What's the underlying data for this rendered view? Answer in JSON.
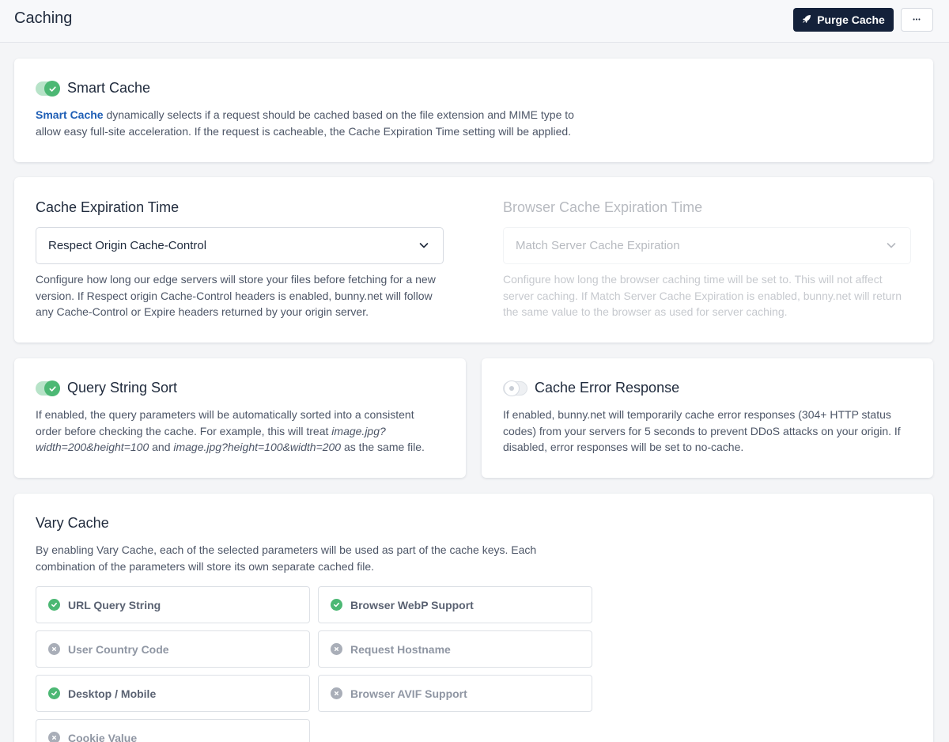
{
  "header": {
    "title": "Caching",
    "purge_label": "Purge Cache",
    "more_label": "•••"
  },
  "smart_cache": {
    "title": "Smart Cache",
    "enabled": true,
    "desc_link": "Smart Cache",
    "desc_line1": " dynamically selects if a request should be cached based on the file extension and MIME type to",
    "desc_line2": "allow easy full-site acceleration. If the request is cacheable, the Cache Expiration Time setting will be applied."
  },
  "cache_expiration": {
    "title": "Cache Expiration Time",
    "selected": "Respect Origin Cache-Control",
    "desc_lines": [
      "Configure how long our edge servers will store your files before fetching for a new",
      "version. If Respect origin Cache-Control headers is enabled, bunny.net will follow",
      "any Cache-Control or Expire headers returned by your origin server."
    ]
  },
  "browser_cache": {
    "title": "Browser Cache Expiration Time",
    "selected": "Match Server Cache Expiration",
    "desc_lines": [
      "Configure how long the browser caching time will be set to. This will not affect",
      "server caching. If Match Server Cache Expiration is enabled, bunny.net will return",
      "the same value to the browser as used for server caching."
    ]
  },
  "query_string_sort": {
    "title": "Query String Sort",
    "enabled": true,
    "line1": "If enabled, the query parameters will be automatically sorted into a consistent",
    "line2": "order before checking the cache. For example, this will treat ",
    "example1_part1": "image.jpg?",
    "example1_part2": "width=200&height=100",
    "and": " and ",
    "example2": "image.jpg?height=100&width=200",
    "tail": " as the same file."
  },
  "cache_error_response": {
    "title": "Cache Error Response",
    "enabled": false,
    "desc_lines": [
      "If enabled, bunny.net will temporarily cache error responses (304+ HTTP status",
      "codes) from your servers for 5 seconds to prevent DDoS attacks on your origin. If",
      "disabled, error responses will be set to no-cache."
    ]
  },
  "vary_cache": {
    "title": "Vary Cache",
    "desc_lines": [
      "By enabling Vary Cache, each of the selected parameters will be used as part of the cache keys. Each",
      "combination of the parameters will store its own separate cached file."
    ],
    "items": [
      {
        "label": "URL Query String",
        "enabled": true
      },
      {
        "label": "Browser WebP Support",
        "enabled": true
      },
      {
        "label": "User Country Code",
        "enabled": false
      },
      {
        "label": "Request Hostname",
        "enabled": false
      },
      {
        "label": "Desktop / Mobile",
        "enabled": true
      },
      {
        "label": "Browser AVIF Support",
        "enabled": false
      },
      {
        "label": "Cookie Value",
        "enabled": false
      }
    ]
  },
  "colors": {
    "primary": "#14213a",
    "success": "#4cb874",
    "link": "#1e5eb5"
  }
}
